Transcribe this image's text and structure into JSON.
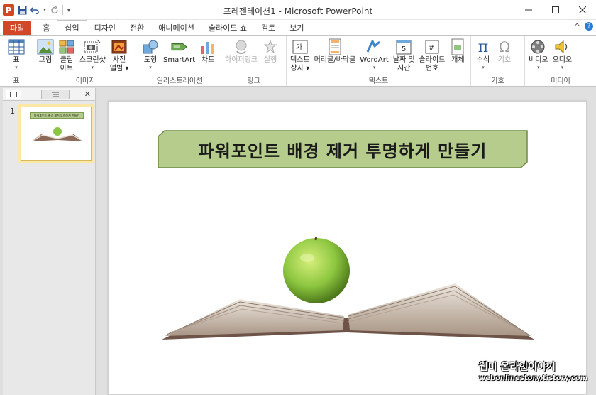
{
  "window": {
    "title": "프레젠테이션1  -  Microsoft PowerPoint",
    "app_logo": "P",
    "controls": [
      "minimize-icon",
      "maximize-icon",
      "close-icon"
    ]
  },
  "tabs": [
    {
      "label": "파일",
      "kind": "file"
    },
    {
      "label": "홈"
    },
    {
      "label": "삽입",
      "active": true
    },
    {
      "label": "디자인"
    },
    {
      "label": "전환"
    },
    {
      "label": "애니메이션"
    },
    {
      "label": "슬라이드 쇼"
    },
    {
      "label": "검토"
    },
    {
      "label": "보기"
    }
  ],
  "ribbon": {
    "groups": {
      "table": "표",
      "image": "이미지",
      "illustration": "일러스트레이션",
      "link": "링크",
      "text": "텍스트",
      "symbol": "기호",
      "media": "미디어"
    },
    "buttons": {
      "table": "표",
      "picture": "그림",
      "clipart_1": "클립",
      "clipart_2": "아트",
      "screenshot": "스크린샷",
      "album_1": "사진",
      "album_2": "앨범",
      "shapes": "도형",
      "smartart": "SmartArt",
      "chart": "차트",
      "hyperlink": "하이퍼링크",
      "action": "실행",
      "textbox_1": "텍스트",
      "textbox_2": "상자",
      "header": "머리글/바닥글",
      "wordart": "WordArt",
      "datetime_1": "날짜 및",
      "datetime_2": "시간",
      "slidenum_1": "슬라이드",
      "slidenum_2": "번호",
      "object": "개체",
      "equation": "수식",
      "symbol": "기호",
      "video": "비디오",
      "audio": "오디오"
    }
  },
  "slides_pane": {
    "thumb_number": "1",
    "thumb_title": "파워포인트 배경 제거 투명하게 만들기"
  },
  "slide": {
    "title": "파워포인트 배경 제거 투명하게 만들기"
  },
  "watermark": {
    "line1": "웹미 온라인이야기",
    "line2": "webonlinestory.tistory.com"
  },
  "colors": {
    "file_tab": "#d24726",
    "title_box_fill": "#b5cc8c",
    "title_box_border": "#6f8b46",
    "apple": "#8cc63f"
  }
}
